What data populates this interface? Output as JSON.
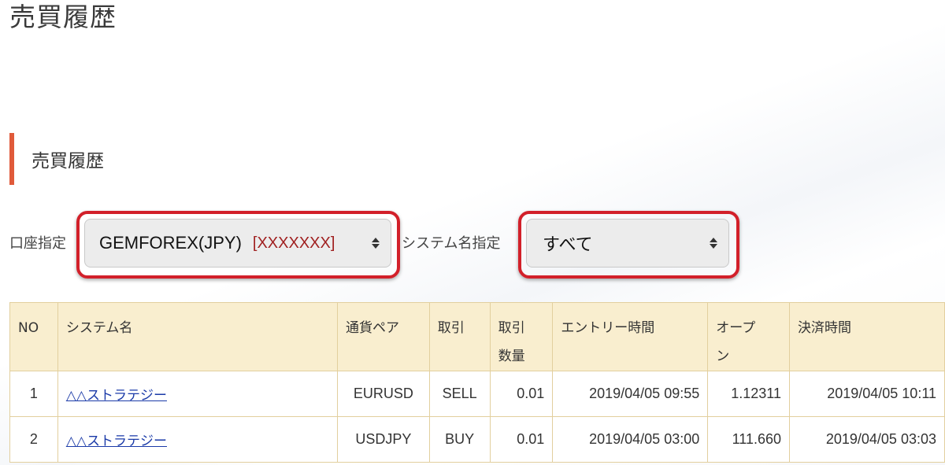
{
  "page": {
    "title": "売買履歴"
  },
  "section": {
    "heading": "売買履歴",
    "accent_color": "#e05a3a"
  },
  "filters": {
    "account_label": "口座指定",
    "account_value": "GEMFOREX(JPY)",
    "account_id": "[XXXXXXX]",
    "system_label": "システム名指定",
    "system_value": "すべて",
    "highlight_color": "#d2202a"
  },
  "table": {
    "headers": [
      "NO",
      "システム名",
      "通貨ペア",
      "取引",
      "取引\n数量",
      "エントリー時間",
      "オープ\nン",
      "決済時間"
    ],
    "header_lines": {
      "quantity": [
        "取引",
        "数量"
      ],
      "open": [
        "オープ",
        "ン"
      ]
    },
    "rows": [
      {
        "no": "1",
        "system": "△△ストラテジー",
        "pair": "EURUSD",
        "trade": "SELL",
        "qty": "0.01",
        "entry_time": "2019/04/05 09:55",
        "open": "1.12311",
        "close_time": "2019/04/05 10:11"
      },
      {
        "no": "2",
        "system": "△△ストラテジー",
        "pair": "USDJPY",
        "trade": "BUY",
        "qty": "0.01",
        "entry_time": "2019/04/05 03:00",
        "open": "111.660",
        "close_time": "2019/04/05 03:03"
      }
    ],
    "header_bg": "#f9eecf",
    "border_color": "#e2cf9e",
    "link_color": "#1a3aa8"
  }
}
